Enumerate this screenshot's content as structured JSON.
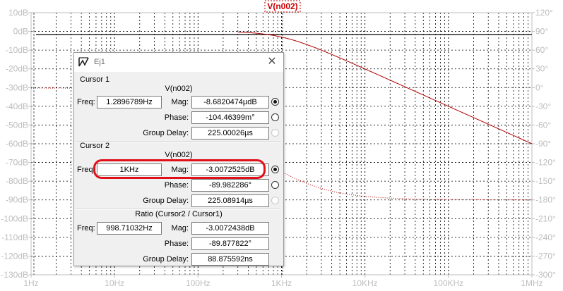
{
  "plot": {
    "trace_title": "V(n002)",
    "left_axis_labels": [
      "10dB",
      "0dB",
      "-10dB",
      "-20dB",
      "-30dB",
      "-40dB",
      "-50dB",
      "-60dB",
      "-70dB",
      "-80dB",
      "-90dB",
      "-100dB",
      "-110dB",
      "-120dB",
      "-130dB"
    ],
    "right_axis_labels": [
      "120°",
      "90°",
      "60°",
      "30°",
      "0°",
      "-30°",
      "-60°",
      "-90°",
      "-120°",
      "-150°",
      "-180°",
      "-210°",
      "-240°",
      "-270°",
      "-300°"
    ],
    "x_axis_labels": [
      "1Hz",
      "10Hz",
      "100Hz",
      "1KHz",
      "10KHz",
      "100KHz",
      "1MHz"
    ],
    "colors": {
      "trace": "#b00000",
      "grid": "#000000",
      "axis_text": "#bdbdbd",
      "highlight": "#e0101a"
    }
  },
  "dialog": {
    "title": "Ej1",
    "close_glyph": "✕",
    "icon": "ltspice-icon",
    "cursor1": {
      "heading": "Cursor 1",
      "trace": "V(n002)",
      "freq_label": "Freq:",
      "freq_value": "1.2896789Hz",
      "mag_label": "Mag:",
      "mag_value": "-8.6820474µdB",
      "phase_label": "Phase:",
      "phase_value": "-104.46399m°",
      "group_delay_label": "Group Delay:",
      "group_delay_value": "225.00026µs"
    },
    "cursor2": {
      "heading": "Cursor 2",
      "trace": "V(n002)",
      "freq_label": "Freq:",
      "freq_value": "1KHz",
      "mag_label": "Mag:",
      "mag_value": "-3.0072525dB",
      "phase_label": "Phase:",
      "phase_value": "-89.982286°",
      "group_delay_label": "Group Delay:",
      "group_delay_value": "225.08914µs"
    },
    "ratio": {
      "heading": "Ratio (Cursor2 / Cursor1)",
      "freq_label": "Freq:",
      "freq_value": "998.71032Hz",
      "mag_label": "Mag:",
      "mag_value": "-3.0072438dB",
      "phase_label": "Phase:",
      "phase_value": "-89.877822°",
      "group_delay_label": "Group Delay:",
      "group_delay_value": "88.875592ns"
    }
  }
}
